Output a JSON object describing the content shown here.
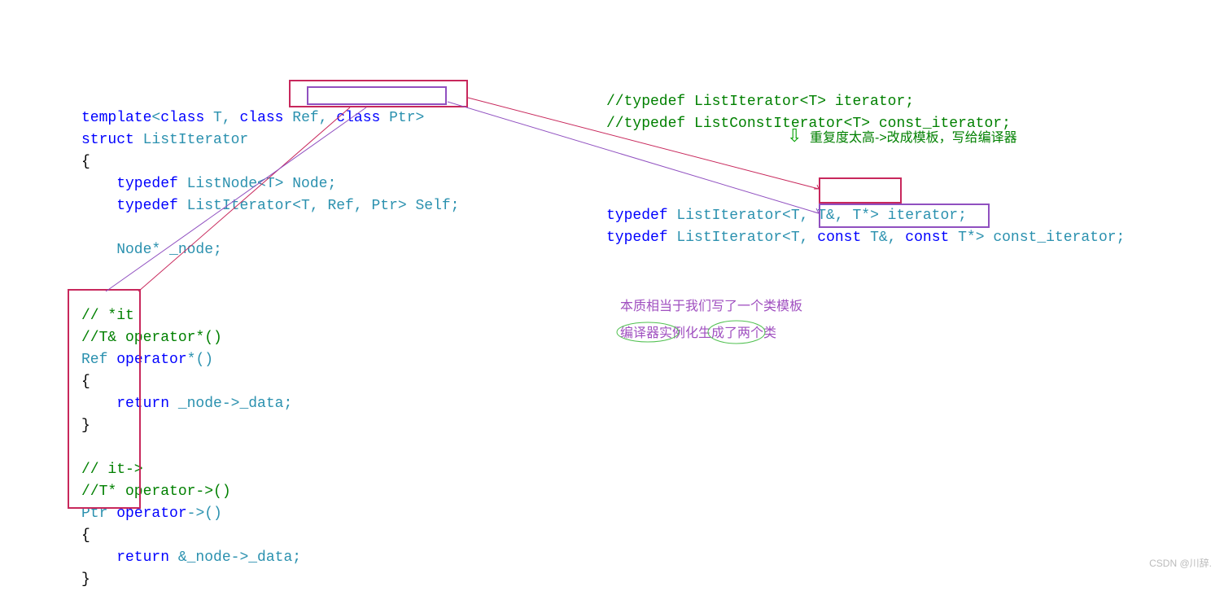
{
  "left": {
    "l1a": "template",
    "l1b": "<",
    "l1c": "class",
    "l1d": " T, ",
    "l1e": "class",
    "l1f": " Ref, ",
    "l1g": "class",
    "l1h": " Ptr>",
    "l2a": "struct",
    "l2b": " ListIterator",
    "l3": "{",
    "l4a": "    typedef",
    "l4b": " ListNode<T> Node;",
    "l5a": "    typedef",
    "l5b": " ListIterator<T, Ref, Ptr> Self;",
    "l6": "",
    "l7": "    Node* _node;",
    "l8": "",
    "l9": "",
    "l10": "// *it",
    "l11": "//T& operator*()",
    "l12a": "Ref ",
    "l12b": "operator",
    "l12c": "*()",
    "l13": "{",
    "l14a": "    return",
    "l14b": " _node->_data;",
    "l15": "}",
    "l16": "",
    "l17": "// it->",
    "l18": "//T* operator->()",
    "l19a": "Ptr ",
    "l19b": "operator",
    "l19c": "->()",
    "l20": "{",
    "l21a": "    return",
    "l21b": " &_node->_data;",
    "l22": "}"
  },
  "right": {
    "l1": "//typedef ListIterator<T> iterator;",
    "l2": "//typedef ListConstIterator<T> const_iterator;",
    "l3a": "typedef",
    "l3b": " ListIterator<T, T&, T*> iterator;",
    "l4a": "typedef",
    "l4b": " ListIterator<T, ",
    "l4c": "const",
    "l4d": " T&, ",
    "l4e": "const",
    "l4f": " T*> const_iterator;"
  },
  "annot": {
    "green": "重复度太高->改成模板，写给编译器",
    "purple1": "本质相当于我们写了一个类模板",
    "purple2": "编译器实例化生成了两个类"
  },
  "watermark": "CSDN @川辞."
}
